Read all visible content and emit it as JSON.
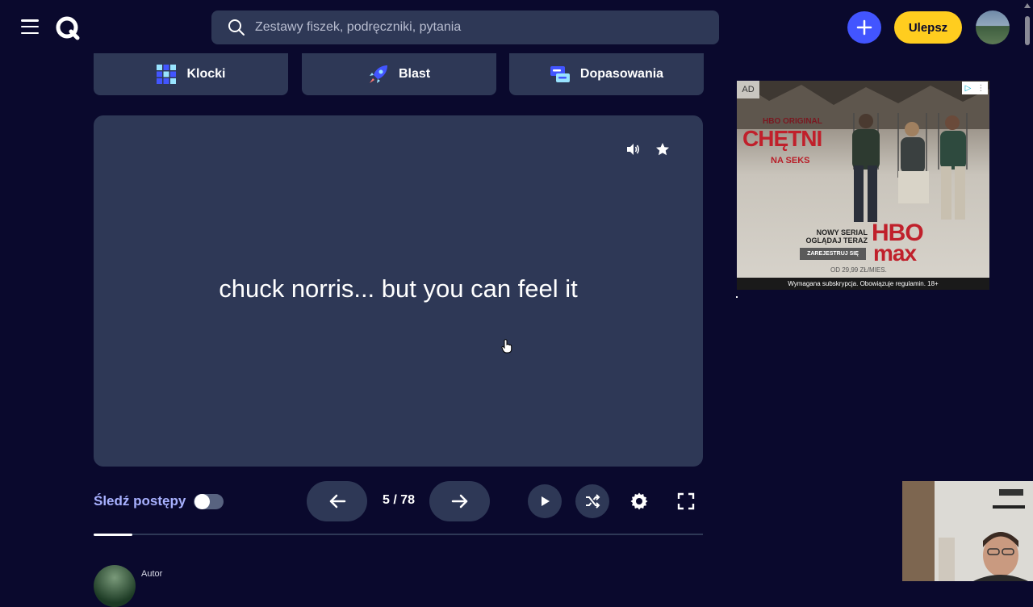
{
  "header": {
    "search_placeholder": "Zestawy fiszek, podręczniki, pytania",
    "upgrade_label": "Ulepsz"
  },
  "modes": [
    {
      "label": "Klocki",
      "icon": "blocks-icon"
    },
    {
      "label": "Blast",
      "icon": "rocket-icon"
    },
    {
      "label": "Dopasowania",
      "icon": "match-icon"
    }
  ],
  "card": {
    "text": "chuck norris... but you can feel it"
  },
  "controls": {
    "track_progress_label": "Śledź postępy",
    "track_progress_on": false,
    "counter": "5 / 78",
    "progress_fraction": 0.064
  },
  "author": {
    "label": "Autor"
  },
  "ad": {
    "badge": "AD",
    "brand_small": "HBO ORIGINAL",
    "title": "CHĘTNI",
    "subtitle": "NA SEKS",
    "new_series": "NOWY SERIAL OGLĄDAJ TERAZ",
    "register": "ZAREJESTRUJ SIĘ",
    "logo_line1": "HBO",
    "logo_line2": "max",
    "price": "OD 29,99 ZŁ/MIES.",
    "footer": "Wymagana subskrypcja. Obowiązuje regulamin. 18+"
  },
  "colors": {
    "background": "#0a092d",
    "surface": "#2e3856",
    "accent_blue": "#4255ff",
    "accent_yellow": "#ffcd1f",
    "track_label": "#a8b1ff"
  }
}
